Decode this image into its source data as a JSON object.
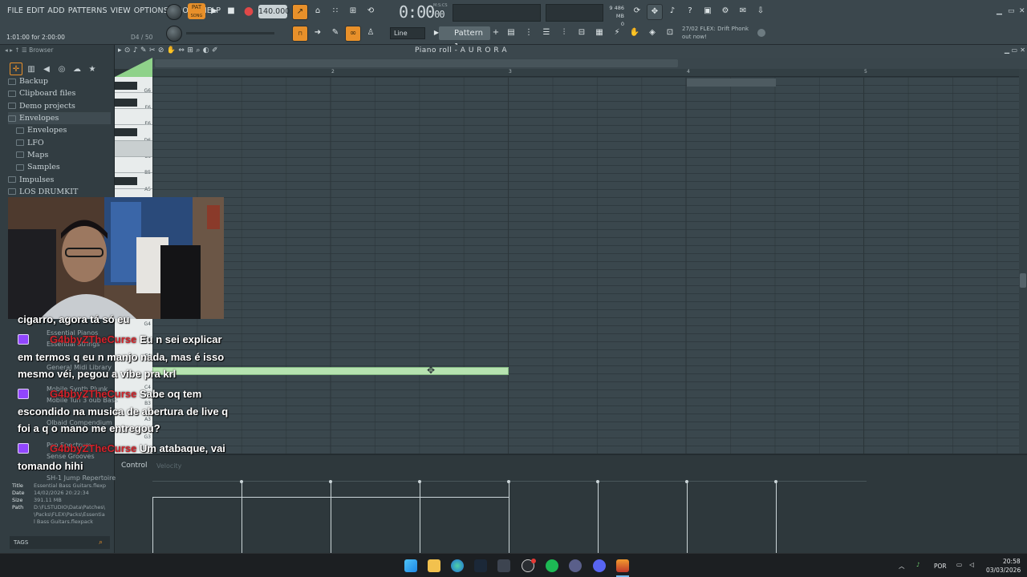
{
  "menu": [
    "FILE",
    "EDIT",
    "ADD",
    "PATTERNS",
    "VIEW",
    "OPTIONS",
    "TOOLS",
    "HELP"
  ],
  "transport": {
    "mode": "PAT",
    "mode_sub": "SONG",
    "tempo": "140.000",
    "time": "0:00",
    "time_ms": "00",
    "time_label": "M:S:CS",
    "hint_left": "1:01:00 for 2:00:00",
    "hint_right": "D4 / 50"
  },
  "monitor": {
    "mem": "486 MB",
    "cpu": "9",
    "voices": "0"
  },
  "toolbar2": {
    "snap": "Line",
    "pattern": "Pattern 1"
  },
  "news": {
    "line1": "27/02  FLEX: Drift Phonk",
    "line2": "out now!"
  },
  "browser": {
    "title": "Browser",
    "items": [
      {
        "label": "Backup",
        "sub": false
      },
      {
        "label": "Clipboard files",
        "sub": false
      },
      {
        "label": "Demo projects",
        "sub": false
      },
      {
        "label": "Envelopes",
        "sub": false,
        "selected": true
      },
      {
        "label": "Envelopes",
        "sub": true
      },
      {
        "label": "LFO",
        "sub": true
      },
      {
        "label": "Maps",
        "sub": true
      },
      {
        "label": "Samples",
        "sub": true
      },
      {
        "label": "Impulses",
        "sub": false
      },
      {
        "label": "LOS DRUMKIT",
        "sub": false
      }
    ],
    "behind": [
      "Essential Pianos",
      "Essential Strings",
      "General Midi Library",
      "Mobile Synth Plunk",
      "Mobile Tun 3 oub Bass",
      "Olbaid Compendium",
      "Pop Spectrum",
      "Sense Grooves",
      "SH-1 Jump Repertoire"
    ],
    "info": {
      "title_k": "Title",
      "title_v": "Essential Bass Guitars.flexp",
      "date_k": "Date",
      "date_v": "14/02/2026 20:22:34",
      "size_k": "Size",
      "size_v": "391.11 MB",
      "path_k": "Path",
      "path_v1": "D:\\FLSTUDIO\\Data\\Patches\\",
      "path_v2": "\\Packs\\FLEX\\Packs\\Essentia",
      "path_v3": "l Bass Guitars.flexpack"
    },
    "tags": "TAGS"
  },
  "piano_roll": {
    "title": "Piano roll - A U R O R A",
    "bars": [
      "2",
      "3",
      "4",
      "5"
    ],
    "keys": [
      "G6",
      "F6",
      "E6",
      "D6",
      "C6",
      "B5",
      "A5",
      "G4",
      "F4",
      "E4",
      "C4",
      "B3",
      "A3",
      "G3"
    ],
    "control_label": "Control",
    "control_ghost": "Velocity"
  },
  "chat": [
    {
      "user": "",
      "text": "cigarro, agora tá só eu"
    },
    {
      "user": "G4bbyZTheCurse",
      "text": "Eu n sei explicar"
    },
    {
      "user": "",
      "text": "em termos q eu n manjo nada, mas é isso"
    },
    {
      "user": "",
      "text": "mesmo véi, pegou a vibe pra krl"
    },
    {
      "user": "G4bbyZTheCurse",
      "text": "Sabe oq tem"
    },
    {
      "user": "",
      "text": "escondido na musica de abertura de live q"
    },
    {
      "user": "",
      "text": "foi a q o mano me entregou?"
    },
    {
      "user": "G4bbyZTheCurse",
      "text": "Um atabaque, vai"
    },
    {
      "user": "",
      "text": "tomando hihi"
    }
  ],
  "taskbar": {
    "lang": "POR",
    "time": "20:58",
    "date": "03/03/2026"
  },
  "colors": {
    "accent": "#e8902a",
    "note": "#b6e3b0",
    "username": "#d3222a",
    "grid": "#3a474d"
  }
}
